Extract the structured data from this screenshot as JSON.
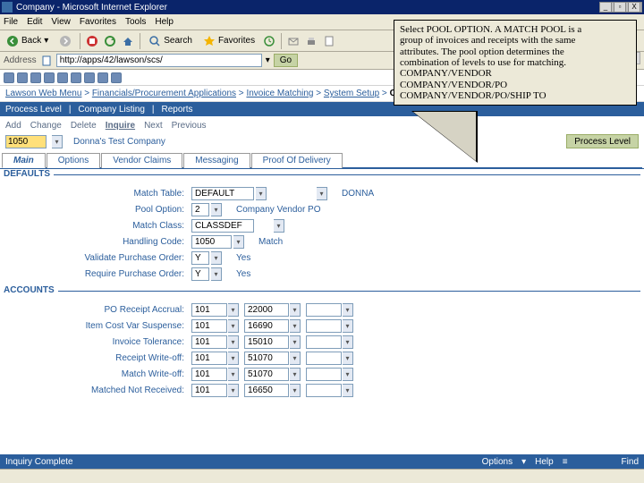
{
  "window": {
    "title": "Company - Microsoft Internet Explorer",
    "min": "_",
    "max": "▫",
    "close": "X"
  },
  "menu": {
    "file": "File",
    "edit": "Edit",
    "view": "View",
    "favorites": "Favorites",
    "tools": "Tools",
    "help": "Help"
  },
  "toolbar": {
    "back": "Back",
    "search": "Search",
    "favorites": "Favorites"
  },
  "address": {
    "label": "Address",
    "url": "http://apps/42/lawson/scs/",
    "go": "Go"
  },
  "links": {
    "label": "Links"
  },
  "breadcrumb": {
    "items": [
      "Lawson Web Menu",
      "Financials/Procurement Applications",
      "Invoice Matching",
      "System Setup"
    ],
    "final": "Company",
    "sep": " > "
  },
  "tabsbar": {
    "process": "Process Level",
    "listing": "Company Listing",
    "reports": "Reports"
  },
  "actions": {
    "add": "Add",
    "change": "Change",
    "delete": "Delete",
    "inquire": "Inquire",
    "next": "Next",
    "previous": "Previous"
  },
  "company": {
    "value": "1050",
    "name": "Donna's Test Company",
    "btn": "Process Level"
  },
  "formtabs": {
    "main": "Main",
    "options": "Options",
    "vendor": "Vendor Claims",
    "messaging": "Messaging",
    "proof": "Proof Of Delivery"
  },
  "sections": {
    "defaults": "DEFAULTS",
    "accounts": "ACCOUNTS"
  },
  "defaults": {
    "rows": [
      {
        "label": "Match Table:",
        "val": "DEFAULT",
        "desc": "DONNA"
      },
      {
        "label": "Pool Option:",
        "val": "2",
        "desc": "Company Vendor PO"
      },
      {
        "label": "Match Class:",
        "val": "CLASSDEF",
        "desc": ""
      },
      {
        "label": "Handling Code:",
        "val": "1050",
        "desc": "Match"
      },
      {
        "label": "Validate Purchase Order:",
        "val": "Y",
        "desc": "Yes"
      },
      {
        "label": "Require Purchase Order:",
        "val": "Y",
        "desc": "Yes"
      }
    ]
  },
  "accounts": {
    "rows": [
      {
        "label": "PO Receipt Accrual:",
        "c": "101",
        "a": "22000"
      },
      {
        "label": "Item Cost Var Suspense:",
        "c": "101",
        "a": "16690"
      },
      {
        "label": "Invoice Tolerance:",
        "c": "101",
        "a": "15010"
      },
      {
        "label": "Receipt Write-off:",
        "c": "101",
        "a": "51070"
      },
      {
        "label": "Match Write-off:",
        "c": "101",
        "a": "51070"
      },
      {
        "label": "Matched Not Received:",
        "c": "101",
        "a": "16650"
      }
    ]
  },
  "callout": {
    "l1": "Select POOL OPTION.  A MATCH POOL is a",
    "l2": "group of invoices and receipts with the same",
    "l3": "attributes.  The pool option determines the",
    "l4": "combination of levels to use for matching.",
    "l5": "COMPANY/VENDOR",
    "l6": "COMPANY/VENDOR/PO",
    "l7": "COMPANY/VENDOR/PO/SHIP TO"
  },
  "statusbar": {
    "msg": "Inquiry Complete",
    "options": "Options",
    "help": "Help",
    "find": "Find",
    "arrow": "▾",
    "q": "?",
    "list": "≡"
  }
}
